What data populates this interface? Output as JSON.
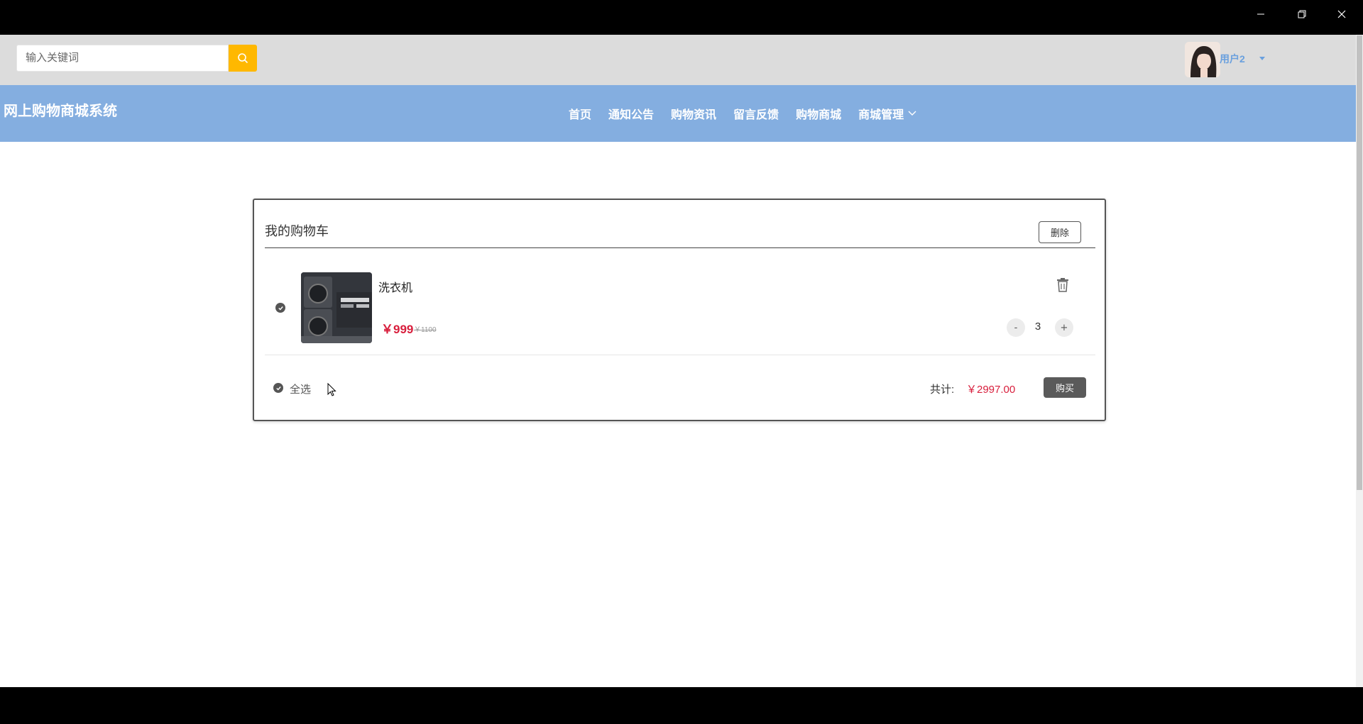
{
  "window": {
    "minimize_icon": "minimize-icon",
    "restore_icon": "restore-icon",
    "close_icon": "close-icon"
  },
  "search": {
    "placeholder": "输入关键词",
    "value": "",
    "icon": "search-icon",
    "button_color": "#ffb800"
  },
  "user": {
    "name": "用户2",
    "avatar": "avatar-image"
  },
  "navbar": {
    "brand": "网上购物商城系统",
    "background": "#84aee0",
    "items": [
      {
        "label": "首页"
      },
      {
        "label": "通知公告"
      },
      {
        "label": "购物资讯"
      },
      {
        "label": "留言反馈"
      },
      {
        "label": "购物商城"
      },
      {
        "label": "商城管理",
        "dropdown": true
      }
    ]
  },
  "cart": {
    "title": "我的购物车",
    "delete_label": "删除",
    "items": [
      {
        "name": "洗衣机",
        "price": "￥999",
        "original_price": "￥1100",
        "quantity": "3",
        "minus_label": "-",
        "plus_label": "+",
        "checked": true
      }
    ],
    "select_all_label": "全选",
    "total_label": "共计:",
    "total_value": "￥2997.00",
    "buy_label": "购买",
    "accent_color": "#d81e3c"
  }
}
